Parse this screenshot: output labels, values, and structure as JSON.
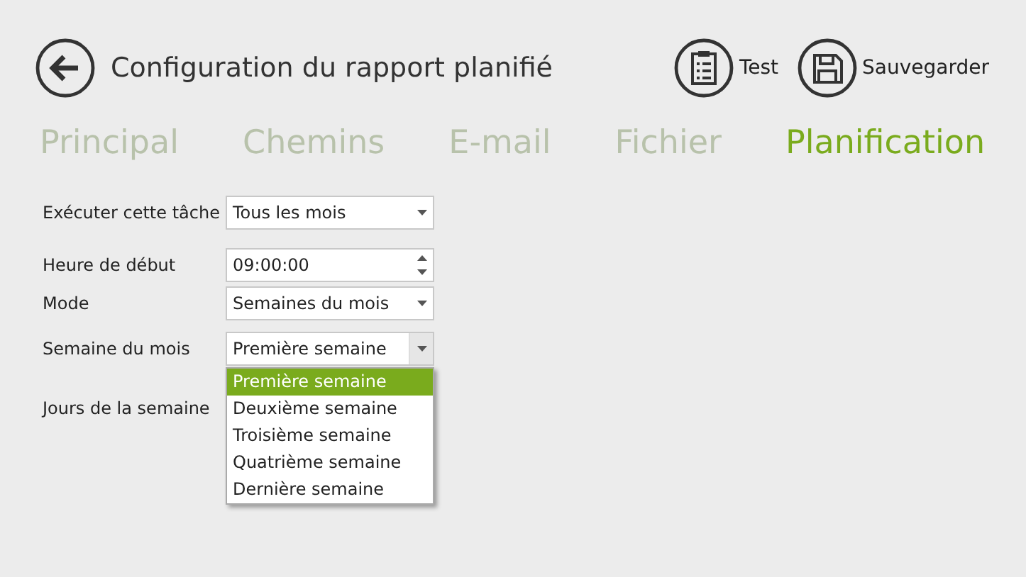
{
  "header": {
    "title": "Configuration du rapport planifié",
    "actions": [
      {
        "kind": "test",
        "label": "Test"
      },
      {
        "kind": "save",
        "label": "Sauvegarder"
      }
    ]
  },
  "tabs": [
    {
      "label": "Principal",
      "selected": false
    },
    {
      "label": "Chemins",
      "selected": false
    },
    {
      "label": "E-mail",
      "selected": false
    },
    {
      "label": "Fichier",
      "selected": false
    },
    {
      "label": "Planification",
      "selected": true
    }
  ],
  "form": [
    {
      "label": "Exécuter cette tâche",
      "kind": "select",
      "value": "Tous les mois"
    },
    {
      "label": "Heure de début",
      "kind": "spinner",
      "value": "09:00:00"
    },
    {
      "label": "Mode",
      "kind": "select",
      "value": "Semaines du mois"
    },
    {
      "label": "Semaine du mois",
      "kind": "select",
      "value": "Première semaine",
      "expanded": true,
      "options": [
        {
          "label": "Première semaine",
          "selected": true
        },
        {
          "label": "Deuxième semaine",
          "selected": false
        },
        {
          "label": "Troisième semaine",
          "selected": false
        },
        {
          "label": "Quatrième semaine",
          "selected": false
        },
        {
          "label": "Dernière semaine",
          "selected": false
        }
      ]
    },
    {
      "label": "Jours de la semaine",
      "kind": "none"
    }
  ]
}
